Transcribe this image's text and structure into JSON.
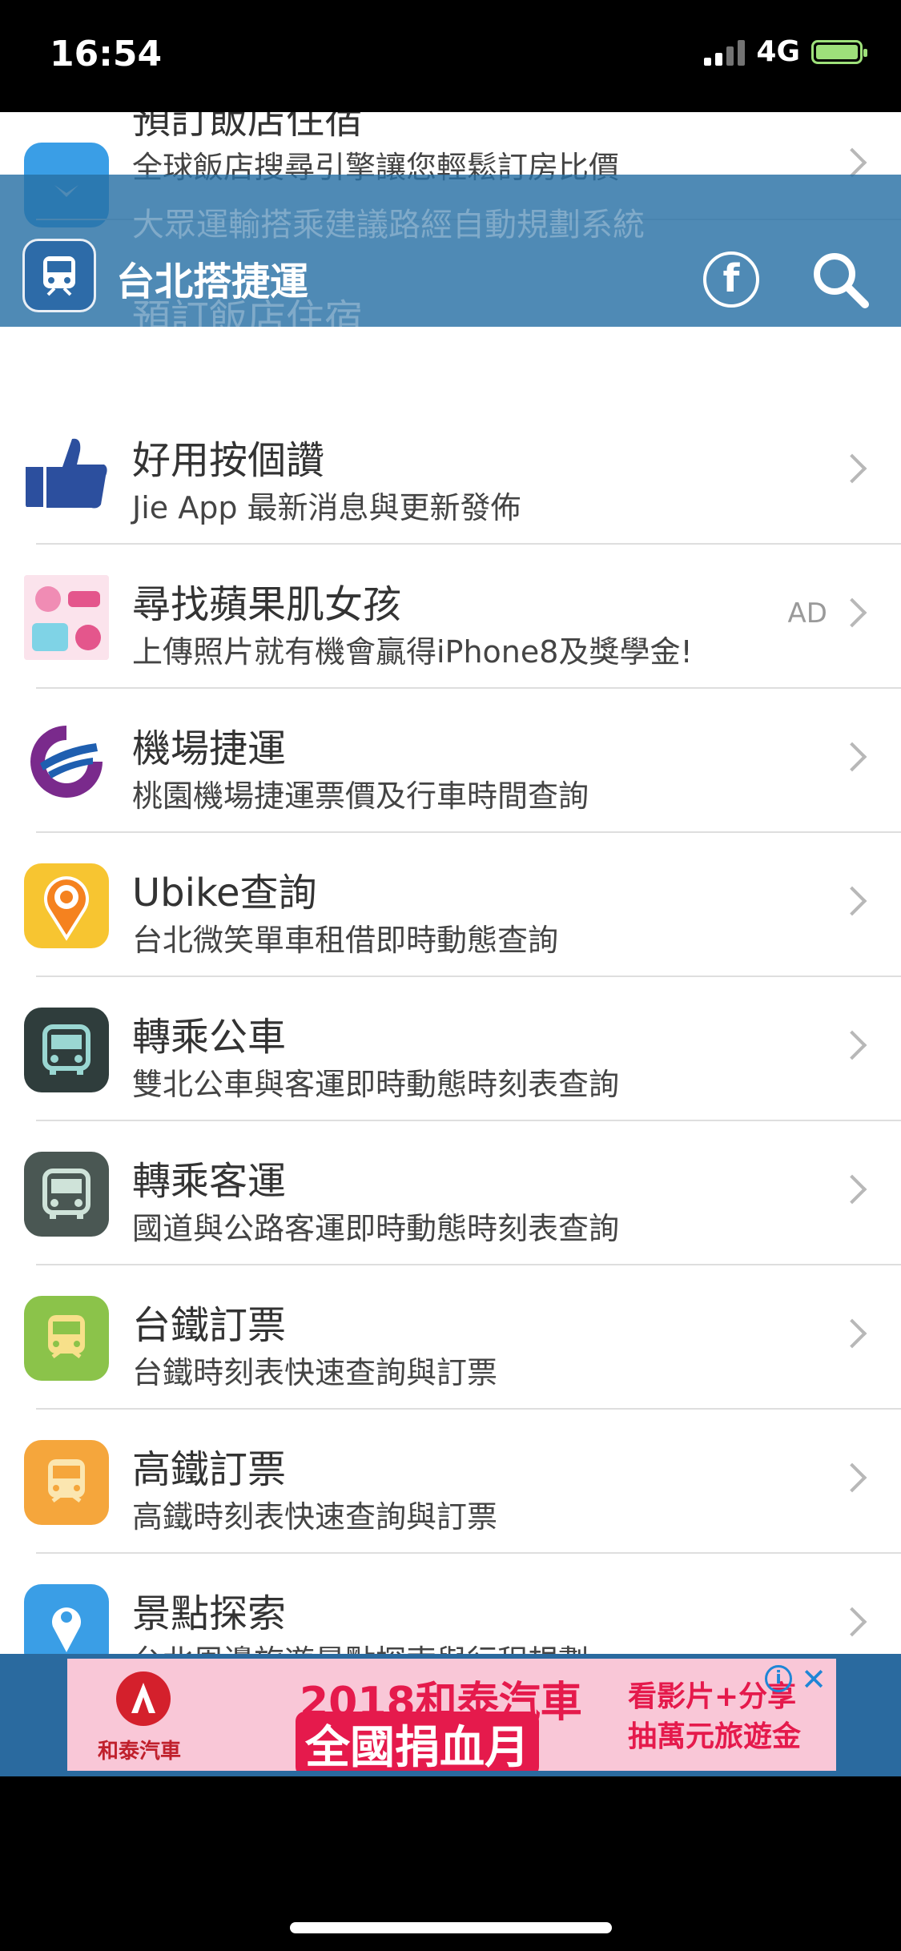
{
  "status_bar": {
    "time": "16:54",
    "network": "4G"
  },
  "header": {
    "title": "台北搭捷運",
    "ghost_subtitle": "大眾運輸搭乘建議路經自動規劃系統",
    "ghost_title": "預訂飯店住宿",
    "fb_icon": "facebook-icon",
    "search_icon": "search-icon"
  },
  "list": {
    "items": [
      {
        "title": "預訂飯店住宿",
        "subtitle": "全球飯店搜尋引擎讓您輕鬆訂房比價",
        "icon": "hotel-icon",
        "color": "#3a9ee6"
      },
      {
        "title": "好用按個讚",
        "subtitle": "Jie App 最新消息與更新發佈",
        "icon": "thumbs-up-icon",
        "color": "#2c4f9e"
      },
      {
        "title": "尋找蘋果肌女孩",
        "subtitle": "上傳照片就有機會贏得iPhone8及獎學金!",
        "icon": "ad-promo-icon",
        "color": "#f08cb4",
        "ad_label": "AD"
      },
      {
        "title": "機場捷運",
        "subtitle": "桃園機場捷運票價及行車時間查詢",
        "icon": "airport-mrt-logo-icon",
        "color": "#7a2a8c"
      },
      {
        "title": "Ubike查詢",
        "subtitle": "台北微笑單車租借即時動態查詢",
        "icon": "ubike-pin-icon",
        "color": "#f7c531"
      },
      {
        "title": "轉乘公車",
        "subtitle": "雙北公車與客運即時動態時刻表查詢",
        "icon": "bus-icon",
        "color": "#2f3d3c"
      },
      {
        "title": "轉乘客運",
        "subtitle": "國道與公路客運即時動態時刻表查詢",
        "icon": "coach-icon",
        "color": "#4a5753"
      },
      {
        "title": "台鐵訂票",
        "subtitle": "台鐵時刻表快速查詢與訂票",
        "icon": "tra-train-icon",
        "color": "#8bc34a"
      },
      {
        "title": "高鐵訂票",
        "subtitle": "高鐵時刻表快速查詢與訂票",
        "icon": "hsr-train-icon",
        "color": "#f5a63c"
      },
      {
        "title": "景點探索",
        "subtitle": "台北周邊旅遊景點探索與行程規劃",
        "icon": "map-pin-icon",
        "color": "#3a9ee6"
      }
    ]
  },
  "ad_banner": {
    "brand": "和泰汽車",
    "headline_1": "2018和泰汽車",
    "headline_2": "全國捐血月",
    "side_1": "看影片+分享",
    "side_2": "抽萬元旅遊金",
    "info_label": "i",
    "close_label": "✕"
  }
}
